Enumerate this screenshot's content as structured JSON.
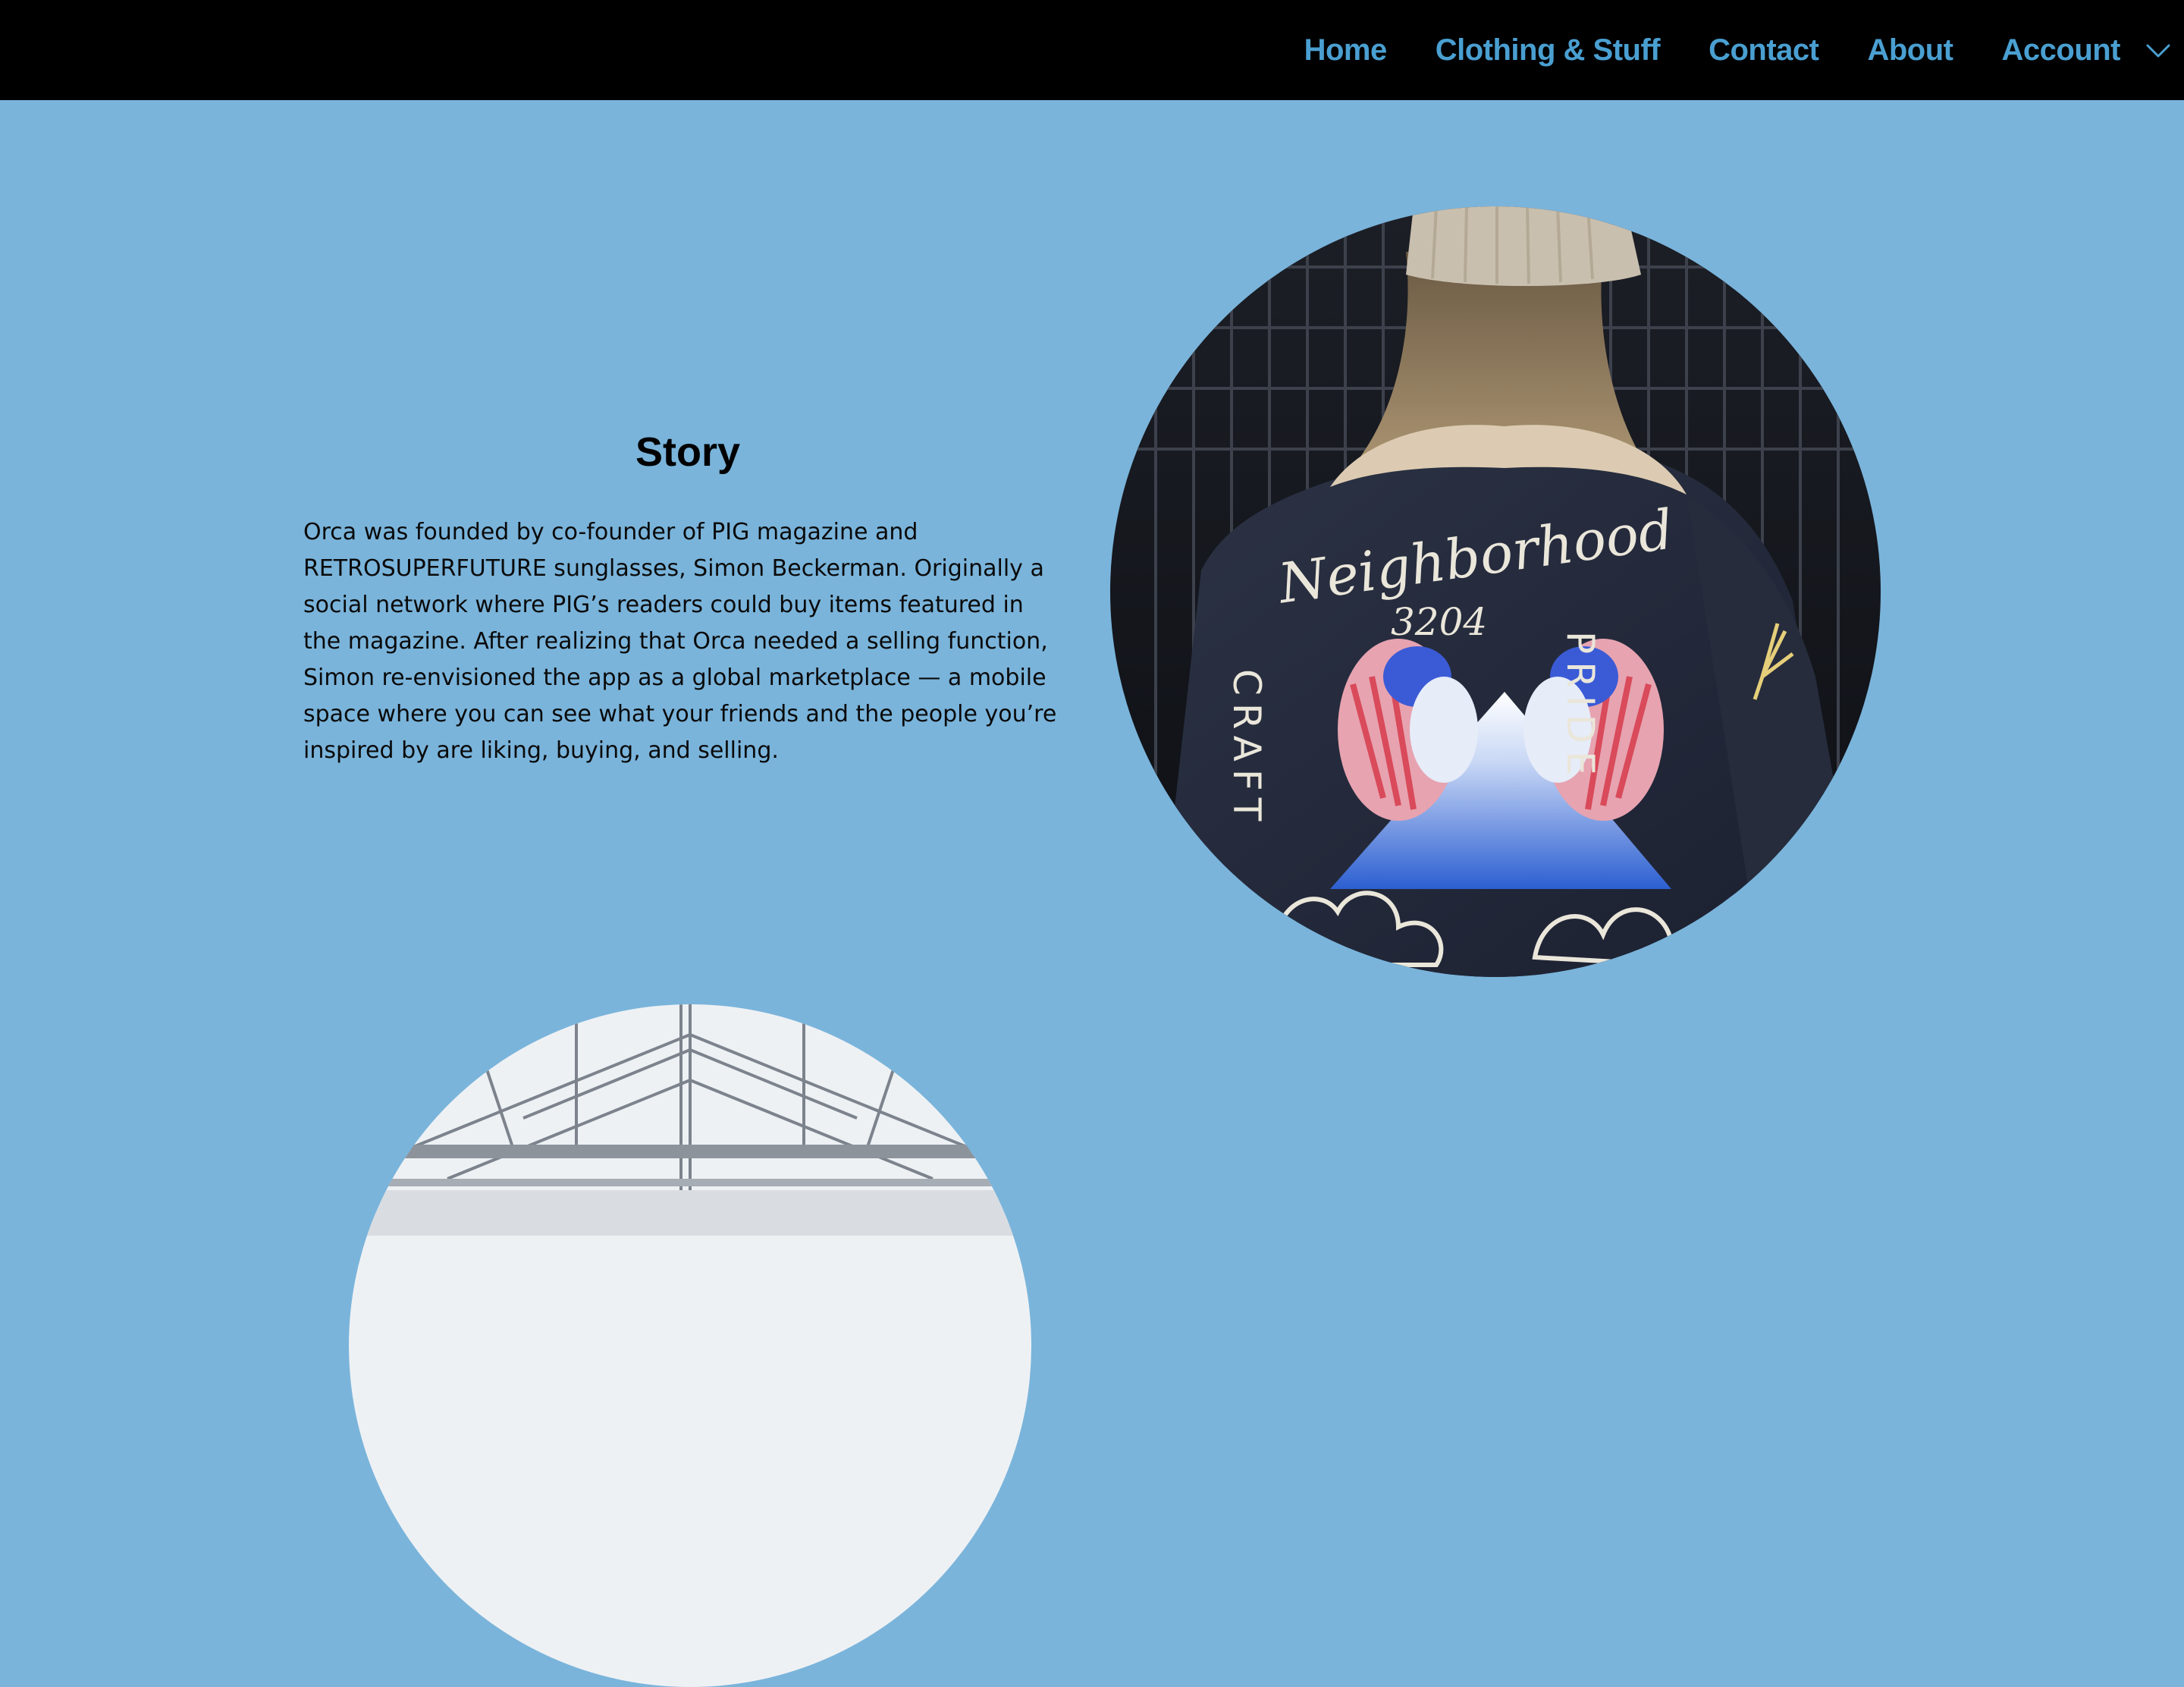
{
  "nav": {
    "items": [
      {
        "label": "Home"
      },
      {
        "label": "Clothing & Stuff"
      },
      {
        "label": "Contact"
      },
      {
        "label": "About"
      },
      {
        "label": "Account"
      }
    ],
    "account_icon": "chevron-down-icon"
  },
  "story": {
    "title": "Story",
    "body": "Orca was founded by co-founder of PIG magazine and RETROSUPERFUTURE sunglasses, Simon Beckerman. Originally a social network where PIG’s readers could buy items featured in the magazine. After realizing that Orca needed a selling function, Simon re-envisioned the app as a global marketplace — a mobile space where you can see what your friends and the people you’re inspired by are liking, buying, and selling."
  },
  "images": {
    "jacket_text_script": "Neighborhood",
    "jacket_text_number": "3204",
    "jacket_text_left": "CRAFT",
    "jacket_text_right": "PRIDE"
  },
  "colors": {
    "background": "#7ab4db",
    "header": "#000000",
    "nav_text": "#4a9fd1"
  }
}
